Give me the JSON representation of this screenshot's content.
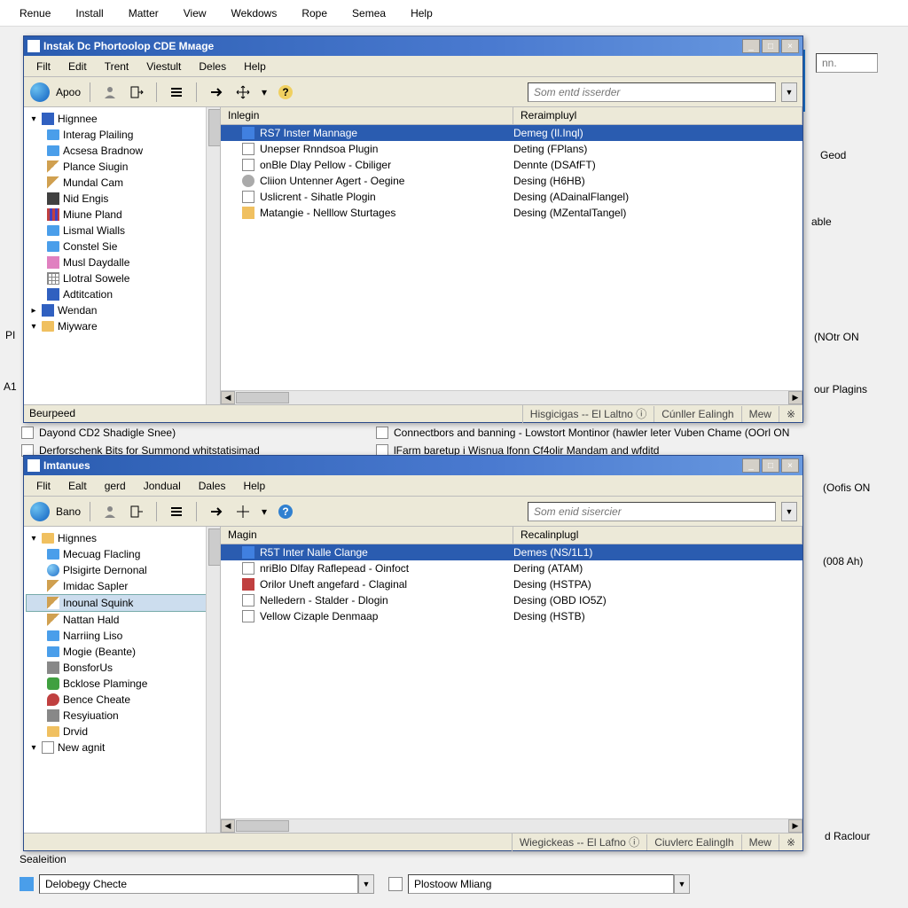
{
  "bg_menu": [
    "Renue",
    "Install",
    "Matter",
    "View",
    "Wekdows",
    "Rope",
    "Semea",
    "Help"
  ],
  "bg_right_button": "nn.",
  "bg_right_text": "Geod",
  "bg_right_text2": "able",
  "bg_text_noton": "(NOtr ON",
  "bg_text_plugins": "our Plagins",
  "bg_items_mid": [
    "Dayond CD2 Shadigle Snee)",
    "Derforschenk Bits for Summond whitstatisimad"
  ],
  "bg_item_conn": "Сonnectbors and banning - Lowstort Montinor (hawler leter Vuben Chame (OOrl ON",
  "bg_item_farm": "lFarm baretup i Wisnua lfonn Cf4olir Mandam and wfditd",
  "bg_text_oofis": "(Oofis ON",
  "bg_text_008": "(008 Ah)",
  "bg_text_radour": "d Raclour",
  "bottom_combo1": "Delobegy Checte",
  "bottom_combo2": "Plostoow Mliang",
  "bg_left_label1": "PI",
  "bg_left_label2": "A1",
  "bg_left_label3": "Sealeition",
  "win1": {
    "title": "Instak Dc Phortoolop CDE Mмage",
    "menus": [
      "Filt",
      "Edit",
      "Trent",
      "Viestult",
      "Deles",
      "Help"
    ],
    "label": "Apoo",
    "search_ph": "Som entd isserder",
    "tree_root": "Hignnee",
    "tree": [
      {
        "ico": "folder-blue",
        "t": "Interag Plailing"
      },
      {
        "ico": "folder-blue",
        "t": "Acsesa Bradnow"
      },
      {
        "ico": "ico-pencil",
        "t": "Plance Siugin"
      },
      {
        "ico": "ico-pencil",
        "t": "Mundal Cam"
      },
      {
        "ico": "ico-sq dark",
        "t": "Nid Engis"
      },
      {
        "ico": "ico-bars",
        "t": "Miune Pland"
      },
      {
        "ico": "folder-blue",
        "t": "Lismal Wialls"
      },
      {
        "ico": "folder-blue",
        "t": "Constel Sie"
      },
      {
        "ico": "ico-sq pink",
        "t": "Musl Daydalle"
      },
      {
        "ico": "ico-grid",
        "t": "Llotral Sowele"
      },
      {
        "ico": "ico-sq blue",
        "t": "Adtitcation"
      }
    ],
    "tree_roots2": [
      "Wendan",
      "Miyware"
    ],
    "side_footer": "Beurpeed",
    "headers": [
      "Inlegin",
      "Reraimpluyl"
    ],
    "rows": [
      {
        "ico": "blue",
        "c1": "RS7 Inster Mannage",
        "c2": "Demeg (Il.Inql)",
        "sel": true
      },
      {
        "ico": "doc",
        "c1": "Unepser Rnndsoa Plugin",
        "c2": "Deting (FPlans)"
      },
      {
        "ico": "doc",
        "c1": "onBle Dlay Pellow - Cbiliger",
        "c2": "Dennte (DSAfFT)"
      },
      {
        "ico": "gear",
        "c1": "Cliion Untenner Agert - Oegine",
        "c2": "Desing (H6HB)"
      },
      {
        "ico": "doc",
        "c1": "Uslicrent - Sihatle Plogin",
        "c2": "Desing (ADainalFlangel)"
      },
      {
        "ico": "fold",
        "c1": "Matangie - Nelllow Sturtages",
        "c2": "Desing (MZentalTangel)"
      }
    ],
    "status": [
      "Hisgicigas -- El Laltno",
      "Cúnller Ealingh",
      "Mew"
    ]
  },
  "win2": {
    "title": "Imtanues",
    "menus": [
      "Flit",
      "Ealt",
      "gerd",
      "Jondual",
      "Dales",
      "Help"
    ],
    "label": "Bano",
    "search_ph": "Som enid sisercier",
    "tree_root": "Hignnes",
    "tree": [
      {
        "ico": "folder-blue",
        "t": "Mecuag Flacling"
      },
      {
        "ico": "ico-globe",
        "t": "Plsigirte Dernonal"
      },
      {
        "ico": "ico-pencil",
        "t": "Imidac Sapler"
      },
      {
        "ico": "ico-pencil",
        "t": "Inounal Squink",
        "sel": true
      },
      {
        "ico": "ico-pencil",
        "t": "Nattan Hald"
      },
      {
        "ico": "folder-blue",
        "t": "Narriing Liso"
      },
      {
        "ico": "folder-blue",
        "t": "Mogie (Beante)"
      },
      {
        "ico": "ico-sq",
        "t": "BonsforUs"
      },
      {
        "ico": "ico-phone",
        "t": "Bcklose Plaminge"
      },
      {
        "ico": "ico-pin",
        "t": "Bence Cheate"
      },
      {
        "ico": "ico-sq",
        "t": "Resyiuation"
      },
      {
        "ico": "folder-yellow",
        "t": "Drvid"
      }
    ],
    "tree_roots2": [
      "New agnit"
    ],
    "side_footer": " ",
    "headers": [
      "Мagin",
      "Recalinplugl"
    ],
    "rows": [
      {
        "ico": "blue",
        "c1": "R5T Inter Nalle Clange",
        "c2": "Demes (NS/1L1)",
        "sel": true
      },
      {
        "ico": "doc",
        "c1": "nriBlo Dlfay Raflepead - Oinfoct",
        "c2": "Dering (ATAM)"
      },
      {
        "ico": "red",
        "c1": "Orilor Uneft angefard - Claginal",
        "c2": "Desing (HSTPA)"
      },
      {
        "ico": "doc",
        "c1": "Nelledern - Stalder - Dlogin",
        "c2": "Desing (OBD IO5Z)"
      },
      {
        "ico": "doc",
        "c1": "Vellow Cizaple Denmaap",
        "c2": "Desing (HSTB)"
      }
    ],
    "status": [
      "Wiegickeas -- El Lafno",
      "Ciuvlerc Ealinglh",
      "Mew"
    ]
  }
}
